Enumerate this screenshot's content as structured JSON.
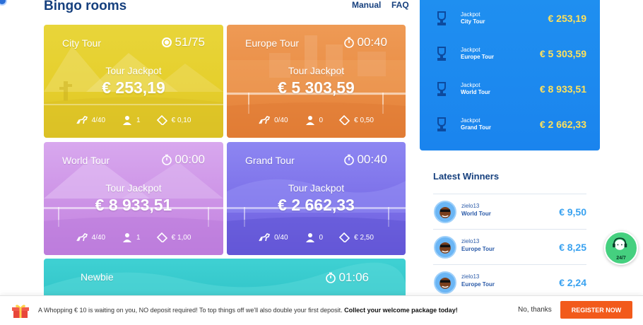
{
  "header": {
    "title": "Bingo rooms",
    "manual_label": "Manual",
    "faq_label": "FAQ"
  },
  "rooms": [
    {
      "name": "City Tour",
      "timer": "51/75",
      "timer_icon": "coin-icon",
      "jackpot_label": "Tour Jackpot",
      "jackpot": "€ 253,19",
      "players": "4/40",
      "users": "1",
      "price": "€ 0,10",
      "color": "#e6cf2c"
    },
    {
      "name": "Europe Tour",
      "timer": "00:40",
      "timer_icon": "stopwatch-icon",
      "jackpot_label": "Tour Jackpot",
      "jackpot": "€ 5 303,59",
      "players": "0/40",
      "users": "0",
      "price": "€ 0,50",
      "color": "#ea8d45"
    },
    {
      "name": "World Tour",
      "timer": "00:00",
      "timer_icon": "stopwatch-icon",
      "jackpot_label": "Tour Jackpot",
      "jackpot": "€ 8 933,51",
      "players": "4/40",
      "users": "1",
      "price": "€ 1,00",
      "color": "#cc92e6"
    },
    {
      "name": "Grand Tour",
      "timer": "00:40",
      "timer_icon": "stopwatch-icon",
      "jackpot_label": "Tour Jackpot",
      "jackpot": "€ 2 662,33",
      "players": "0/40",
      "users": "0",
      "price": "€ 2,50",
      "color": "#7b6fe8"
    },
    {
      "name": "Newbie",
      "timer": "01:06",
      "timer_icon": "stopwatch-icon",
      "color": "#31c4c8"
    }
  ],
  "jackpots": [
    {
      "prefix": "Jackpot",
      "name": "City Tour",
      "value": "€ 253,19",
      "icon": "trophy-icon"
    },
    {
      "prefix": "Jackpot",
      "name": "Europe Tour",
      "value": "€ 5 303,59",
      "icon": "trophy-icon"
    },
    {
      "prefix": "Jackpot",
      "name": "World Tour",
      "value": "€ 8 933,51",
      "icon": "trophy-icon"
    },
    {
      "prefix": "Jackpot",
      "name": "Grand Tour",
      "value": "€ 2 662,33",
      "icon": "trophy-icon"
    }
  ],
  "latest_winners": {
    "title": "Latest Winners",
    "items": [
      {
        "user": "zielo13",
        "room": "World Tour",
        "amount": "€ 9,50"
      },
      {
        "user": "zielo13",
        "room": "Europe Tour",
        "amount": "€ 8,25"
      },
      {
        "user": "zielo13",
        "room": "Europe Tour",
        "amount": "€ 2,24"
      }
    ]
  },
  "support": {
    "label": "24/7",
    "icon": "support-agent-icon"
  },
  "banner": {
    "message": "A Whopping € 10 is waiting on you, NO deposit required!  To top things off we'll also double your first deposit. ",
    "message_bold": "Collect your welcome package today!",
    "no_thanks": "No, thanks",
    "register": "REGISTER NOW",
    "icon": "gift-icon"
  },
  "colors": {
    "brand_blue": "#16407e",
    "panel_blue": "#1a84ee",
    "jackpot_yellow": "#ffe15a",
    "winner_amount": "#39a2f0",
    "register_orange": "#f25a1b",
    "support_green": "#45d07f"
  }
}
